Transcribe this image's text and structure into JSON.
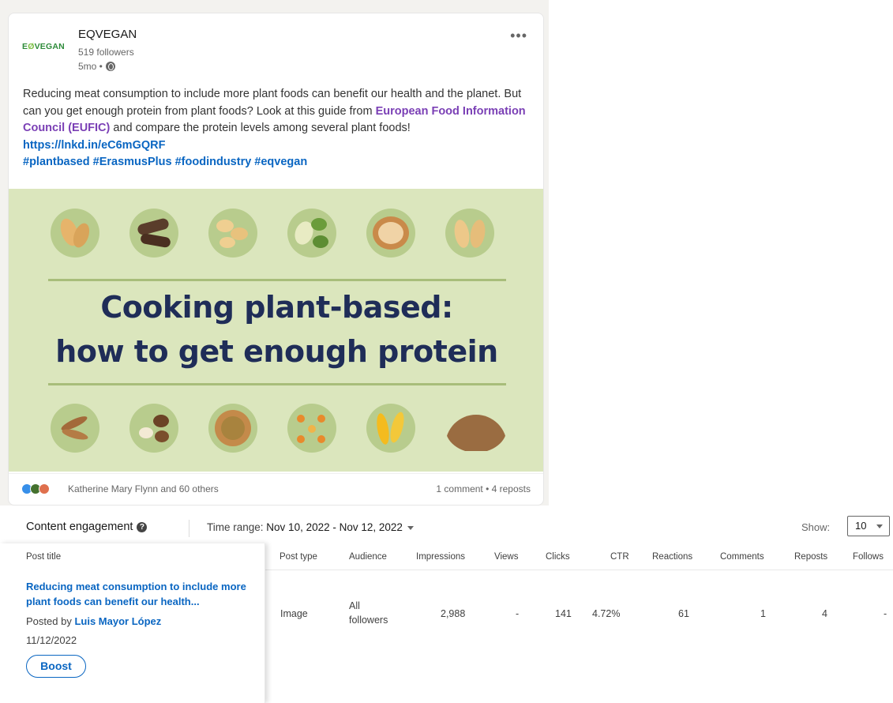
{
  "post": {
    "company": "EQVEGAN",
    "logo_text_1": "E",
    "logo_text_2": "VEGAN",
    "followers": "519 followers",
    "age": "5mo •",
    "more_icon": "more-dots-icon",
    "text_1": "Reducing meat consumption to include more plant foods can benefit our health and the planet. But can you get enough protein from plant foods? Look at this guide from ",
    "link_text": "European Food Information Council (EUFIC)",
    "text_2": " and compare the protein levels among several plant foods! ",
    "url": "https://lnkd.in/eC6mGQRF",
    "hashtags": "#plantbased #ErasmusPlus #foodindustry #eqvegan",
    "image_headline_1": "Cooking plant-based:",
    "image_headline_2": "how to get enough protein",
    "reactions_text": "Katherine Mary Flynn and 60 others",
    "counts_text": "1 comment • 4 reposts"
  },
  "engagement": {
    "title": "Content engagement",
    "time_range_label": "Time range:",
    "time_range_value": "Nov 10, 2022 - Nov 12, 2022",
    "show_label": "Show:",
    "show_value": "10",
    "columns": [
      "Post title",
      "Post type",
      "Audience",
      "Impressions",
      "Views",
      "Clicks",
      "CTR",
      "Reactions",
      "Comments",
      "Reposts",
      "Follows"
    ],
    "row": {
      "title": "Reducing meat consumption to include more plant foods can benefit our health...",
      "posted_by_label": "Posted by",
      "posted_by": "Luis Mayor López",
      "date": "11/12/2022",
      "boost": "Boost",
      "post_type": "Image",
      "audience_1": "All",
      "audience_2": "followers",
      "impressions": "2,988",
      "views": "-",
      "clicks": "141",
      "ctr": "4.72%",
      "reactions": "61",
      "comments": "1",
      "reposts": "4",
      "follows": "-"
    }
  }
}
